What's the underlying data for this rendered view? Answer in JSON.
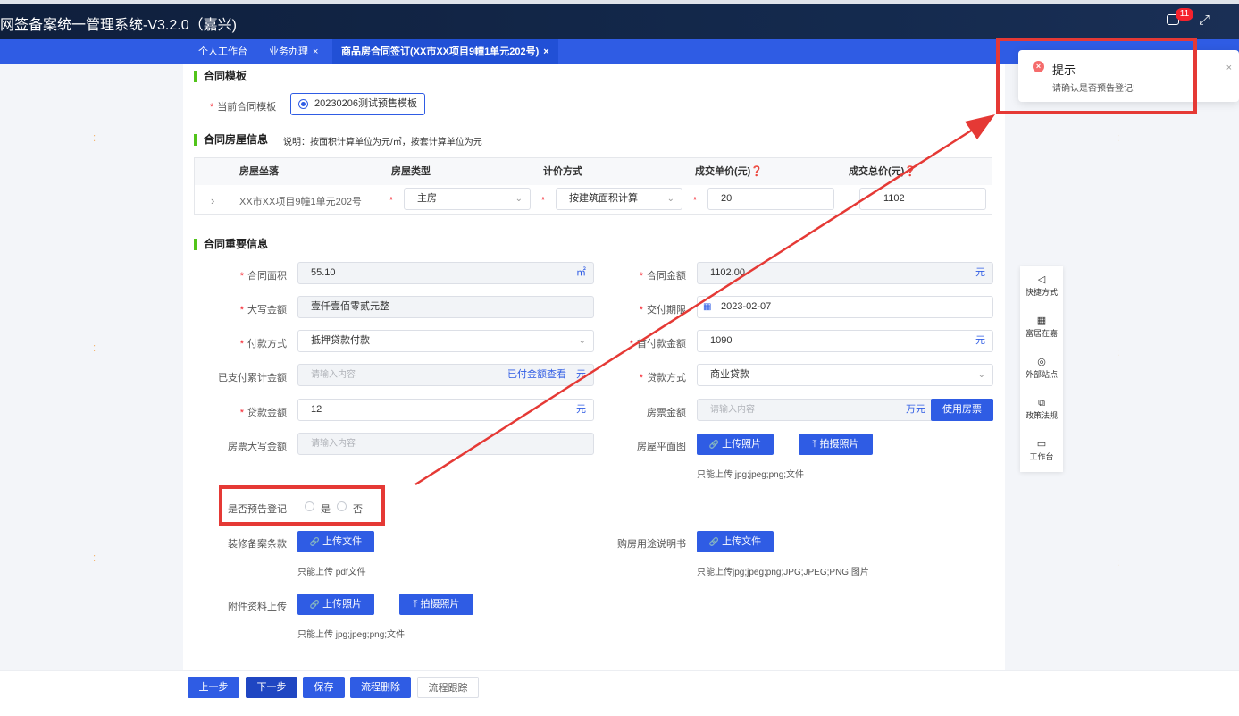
{
  "app": {
    "title": "网签备案统一管理系统-V3.2.0（嘉兴)",
    "notification_count": "11"
  },
  "tabs": [
    {
      "label": "个人工作台",
      "closable": false
    },
    {
      "label": "业务办理",
      "closable": true
    },
    {
      "label": "商品房合同签订(XX市XX项目9幢1单元202号)",
      "closable": true
    }
  ],
  "tab_close": "×",
  "template_section": {
    "title": "合同模板",
    "label": "当前合同模板",
    "selected": "20230206测试预售模板"
  },
  "house_section": {
    "title": "合同房屋信息",
    "note": "说明：按面积计算单位为元/㎡，按套计算单位为元",
    "columns": [
      "房屋坐落",
      "房屋类型",
      "计价方式",
      "成交单价(元)❓",
      "成交总价(元)❓"
    ],
    "row": {
      "expand": "›",
      "location": "XX市XX项目9幢1单元202号",
      "type": "主房",
      "pricing": "按建筑面积计算",
      "unit_price": "20",
      "total_price": "1102"
    }
  },
  "key_section": {
    "title": "合同重要信息",
    "area": {
      "label": "合同面积",
      "value": "55.10",
      "unit": "㎡"
    },
    "amount": {
      "label": "合同金额",
      "value": "1102.00",
      "unit": "元"
    },
    "uppercase": {
      "label": "大写金额",
      "value": "壹仟壹佰零贰元整"
    },
    "delivery": {
      "label": "交付期限",
      "value": "2023-02-07"
    },
    "payment_method": {
      "label": "付款方式",
      "value": "抵押贷款付款"
    },
    "first_payment": {
      "label": "首付款金额",
      "value": "1090",
      "unit": "元"
    },
    "paid_total": {
      "label": "已支付累计金额",
      "placeholder": "请输入内容",
      "link": "已付金额查看",
      "unit": "元"
    },
    "loan_method": {
      "label": "贷款方式",
      "value": "商业贷款"
    },
    "loan_amount": {
      "label": "贷款金额",
      "value": "12",
      "unit": "元"
    },
    "voucher_amount": {
      "label": "房票金额",
      "placeholder": "请输入内容",
      "unit": "万元",
      "button": "使用房票"
    },
    "voucher_upper": {
      "label": "房票大写金额",
      "placeholder": "请输入内容"
    },
    "floor_plan": {
      "label": "房屋平面图",
      "upload": "上传照片",
      "shoot": "拍摄照片",
      "hint": "只能上传 jpg;jpeg;png;文件"
    },
    "pre_register": {
      "label": "是否预告登记",
      "yes": "是",
      "no": "否"
    },
    "decoration": {
      "label": "装修备案条款",
      "upload": "上传文件",
      "hint": "只能上传 pdf文件"
    },
    "purpose": {
      "label": "购房用途说明书",
      "upload": "上传文件",
      "hint": "只能上传jpg;jpeg;png;JPG;JPEG;PNG;图片"
    },
    "attachment": {
      "label": "附件资料上传",
      "upload": "上传照片",
      "shoot": "拍摄照片",
      "hint": "只能上传 jpg;jpeg;png;文件"
    }
  },
  "required_mark": "*",
  "toast": {
    "title": "提示",
    "message": "请确认是否预告登记!",
    "close": "×",
    "icon": "×"
  },
  "side_panel": [
    {
      "label": "快捷方式",
      "icon": "send-icon",
      "glyph": "◁"
    },
    {
      "label": "富居在嘉",
      "icon": "qrcode-icon",
      "glyph": "▦"
    },
    {
      "label": "外部站点",
      "icon": "globe-icon",
      "glyph": "◎"
    },
    {
      "label": "政策法规",
      "icon": "copy-icon",
      "glyph": "⧉"
    },
    {
      "label": "工作台",
      "icon": "monitor-icon",
      "glyph": "▭"
    }
  ],
  "footer": {
    "prev": "上一步",
    "next": "下一步",
    "save": "保存",
    "delete": "流程删除",
    "trace": "流程跟踪"
  },
  "icons": {
    "link": "🔗",
    "upload": "⤒",
    "calendar": "▦",
    "chevron": "⌄",
    "fullscreen": "⤢"
  },
  "colors": {
    "primary": "#2f5ce4",
    "topbar": "#0f1f3c",
    "annotation": "#e53935",
    "required": "#f5222d"
  }
}
